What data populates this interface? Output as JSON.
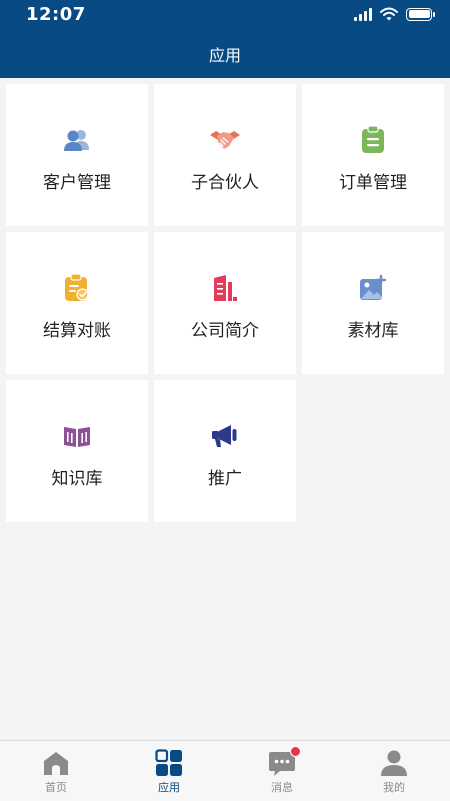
{
  "status_bar": {
    "time": "12:07"
  },
  "header": {
    "title": "应用"
  },
  "apps": [
    {
      "label": "客户管理",
      "icon": "users-icon",
      "color": "#5b86c5"
    },
    {
      "label": "子合伙人",
      "icon": "handshake-icon",
      "color": "#e5735c"
    },
    {
      "label": "订单管理",
      "icon": "clipboard-list-icon",
      "color": "#7cb85a"
    },
    {
      "label": "结算对账",
      "icon": "clipboard-check-icon",
      "color": "#f0b030"
    },
    {
      "label": "公司简介",
      "icon": "building-icon",
      "color": "#e23c5c"
    },
    {
      "label": "素材库",
      "icon": "image-add-icon",
      "color": "#6a8fcc"
    },
    {
      "label": "知识库",
      "icon": "book-icon",
      "color": "#8e5096"
    },
    {
      "label": "推广",
      "icon": "megaphone-icon",
      "color": "#2d3a8c"
    }
  ],
  "tabbar": {
    "items": [
      {
        "label": "首页",
        "icon": "home-icon",
        "active": false
      },
      {
        "label": "应用",
        "icon": "apps-grid-icon",
        "active": true
      },
      {
        "label": "消息",
        "icon": "message-icon",
        "active": false,
        "badge": true
      },
      {
        "label": "我的",
        "icon": "user-icon",
        "active": false
      }
    ]
  },
  "colors": {
    "primary": "#074a84",
    "background": "#f4f4f4",
    "inactive_tab": "#8a8a8a",
    "badge": "#e8334a"
  }
}
